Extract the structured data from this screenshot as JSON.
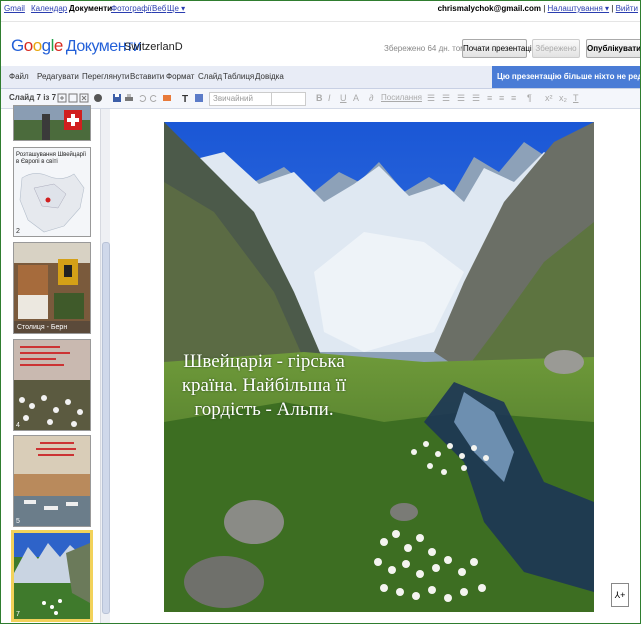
{
  "topbar": {
    "links": [
      "Gmail",
      "Календар",
      "Документи",
      "Фотографії",
      "Веб",
      "Ще ▾"
    ],
    "email": "chrismalychok@gmail.com",
    "settings": "Налаштування ▾",
    "signout": "Вийти"
  },
  "header": {
    "logo_google": "Google",
    "logo_product": "Документи",
    "doc_title": "SwitzerlanD",
    "saved_status": "Збережено 64 дн. тому",
    "start_presentation": "Почати презентацію",
    "save": "Збережено",
    "publish": "Опублікувати ▾"
  },
  "menu": {
    "items": [
      "Файл",
      "Редагувати",
      "Переглянути",
      "Вставити",
      "Формат",
      "Слайд",
      "Таблиця",
      "Довідка"
    ],
    "notice": "Цю презентацію більше ніхто не редагує."
  },
  "toolbar": {
    "slide_counter": "Слайд 7 із 7",
    "font_select": "Звичайний",
    "link_label": "Посилання"
  },
  "slides": {
    "thumbs": [
      {
        "num": "",
        "caption": ""
      },
      {
        "num": "2",
        "caption": "Розташування Швейцарії в Європі в світі"
      },
      {
        "num": "3",
        "caption": "Столиця - Берн"
      },
      {
        "num": "4",
        "caption": ""
      },
      {
        "num": "5",
        "caption": ""
      },
      {
        "num": "7",
        "caption": ""
      }
    ]
  },
  "slide": {
    "text_line1": "Швейцарія - гірська",
    "text_line2": "країна. Найбільша її",
    "text_line3": "гордість - Альпи."
  },
  "colors": {
    "accent": "#4a7cd6",
    "menu_bg": "#e8ecf6",
    "selected_thumb": "#f2d25a"
  }
}
